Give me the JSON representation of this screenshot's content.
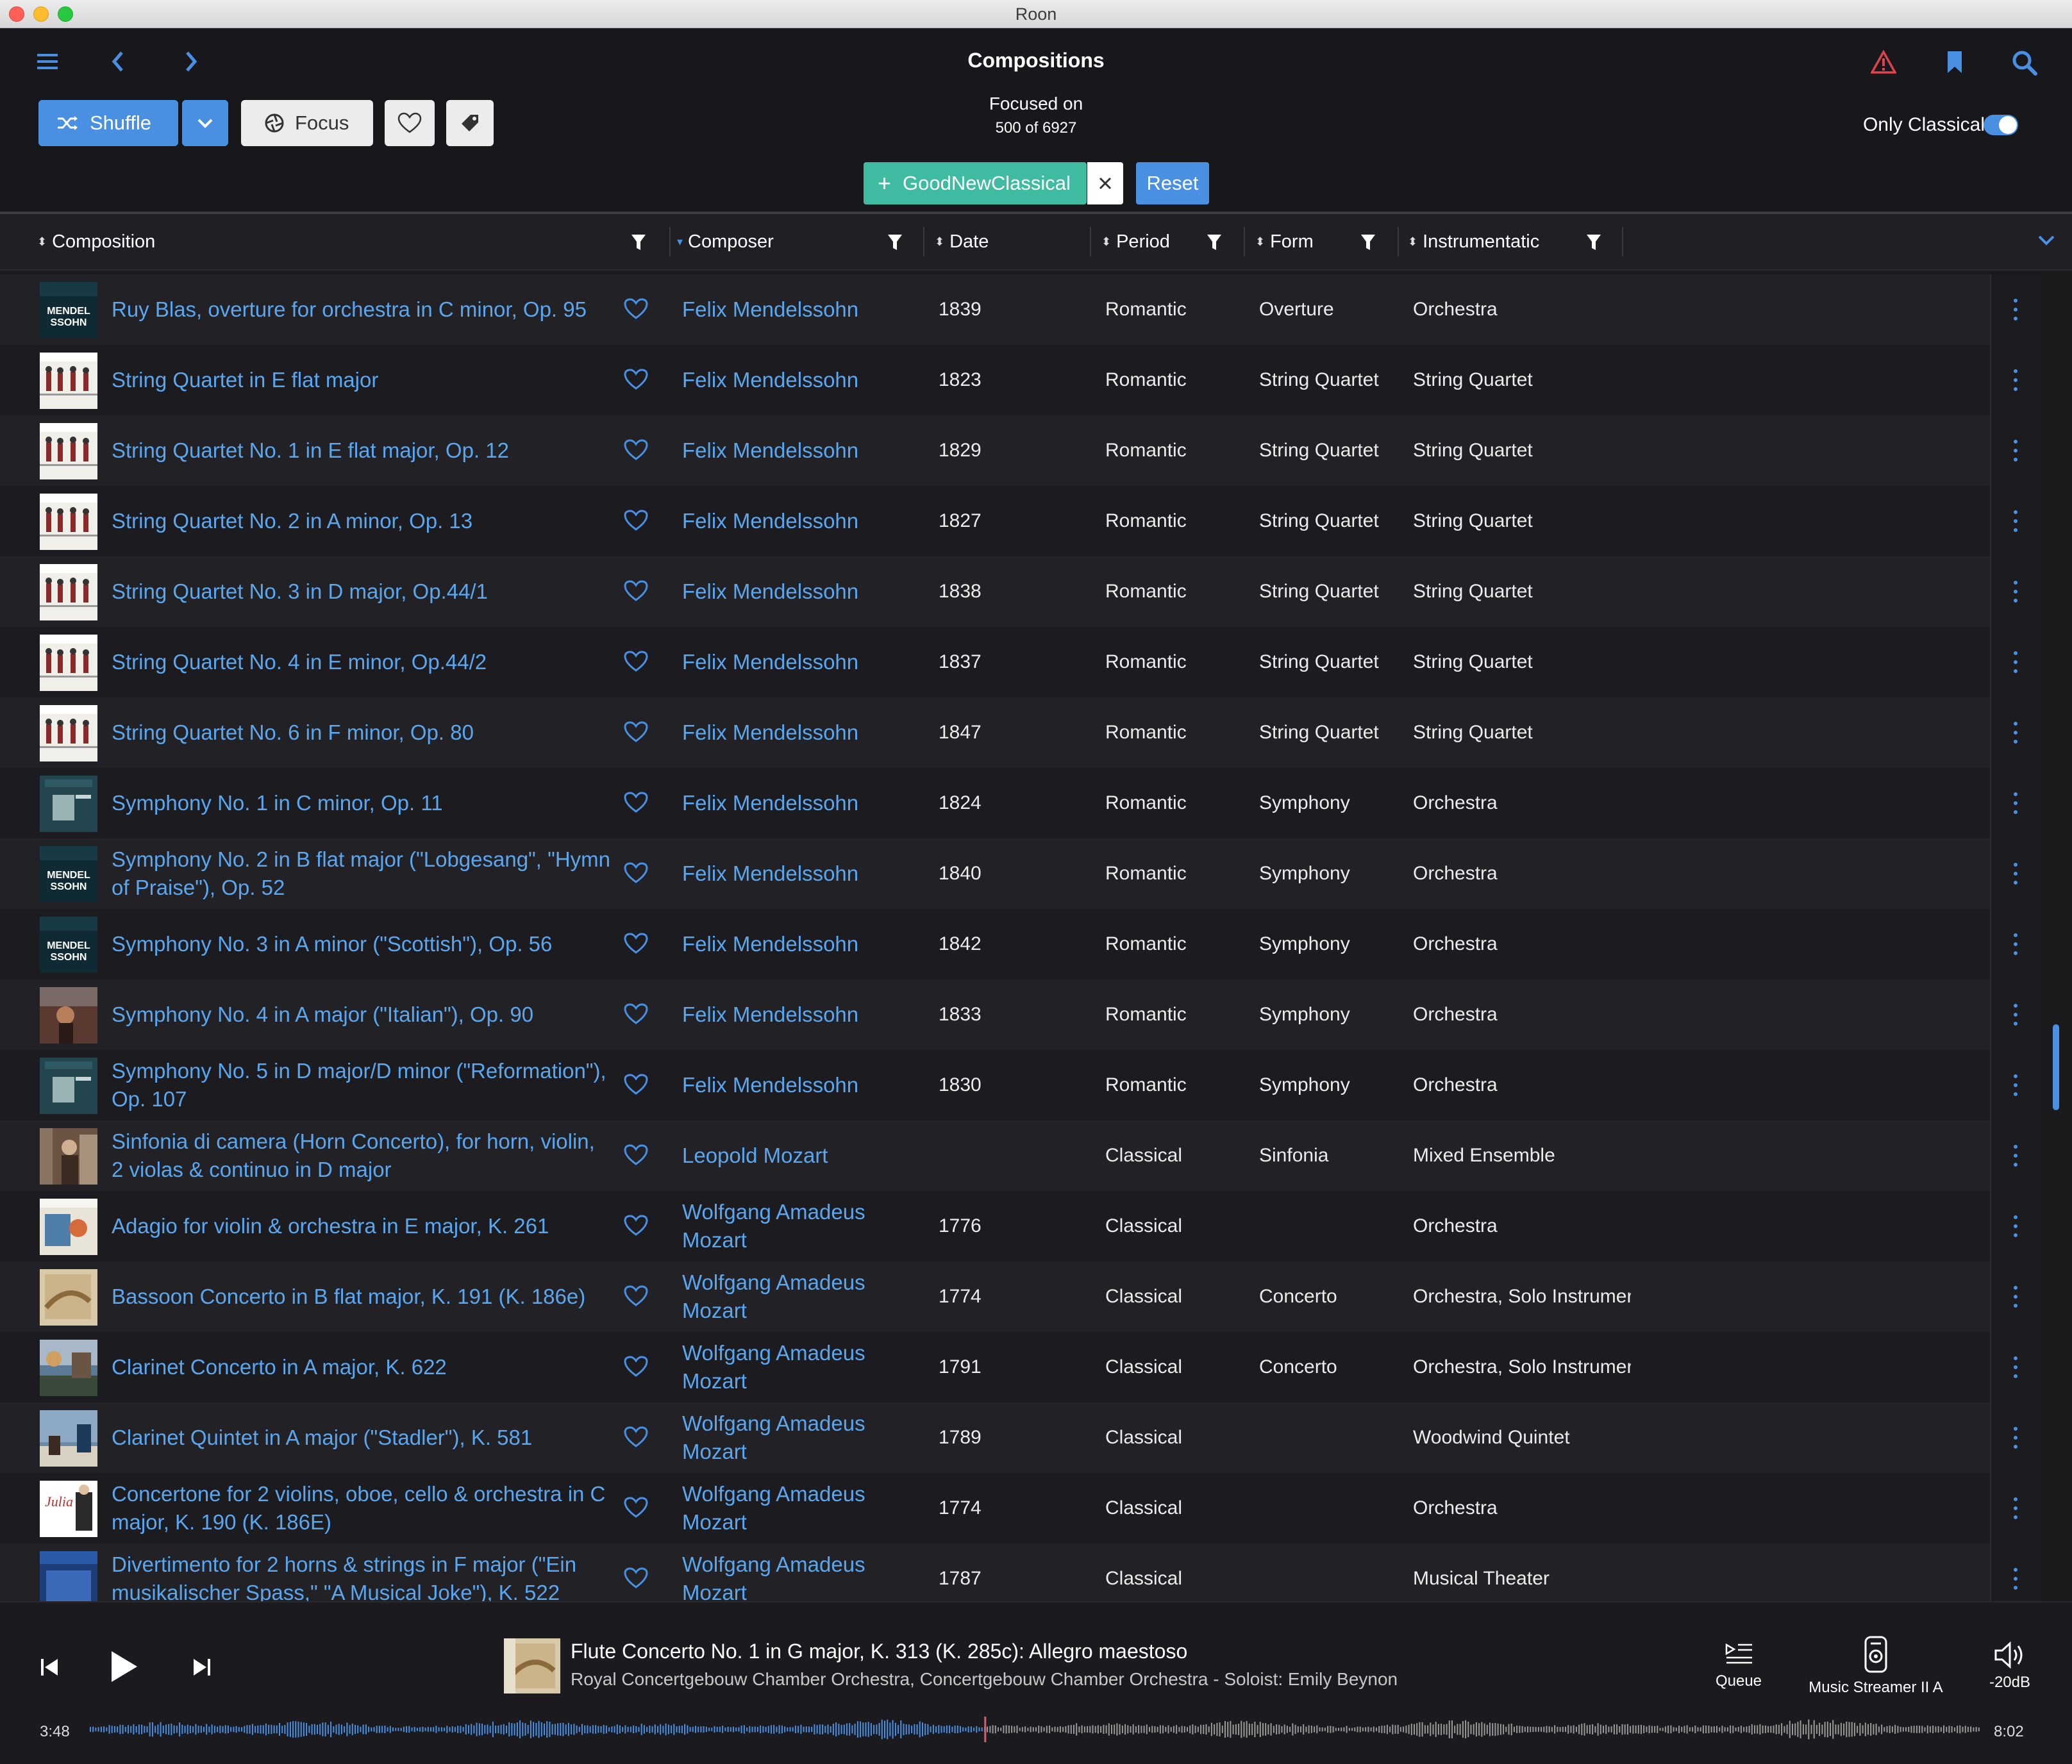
{
  "window": {
    "title": "Roon"
  },
  "header": {
    "page_title": "Compositions",
    "focused_label": "Focused on",
    "focused_count": "500 of 6927",
    "shuffle_label": "Shuffle",
    "focus_label": "Focus",
    "filter_chip": "GoodNewClassical",
    "reset_label": "Reset",
    "only_classical_label": "Only Classical",
    "only_classical_on": true
  },
  "columns": {
    "composition": "Composition",
    "composer": "Composer",
    "date": "Date",
    "period": "Period",
    "form": "Form",
    "instrumentation": "Instrumentatic"
  },
  "rows": [
    {
      "title": "Ruy Blas, overture for orchestra in C minor, Op. 95",
      "composer": "Felix Mendelssohn",
      "date": "1839",
      "period": "Romantic",
      "form": "Overture",
      "instrumentation": "Orchestra",
      "art": "mendelssohn"
    },
    {
      "title": "String Quartet in E flat major",
      "composer": "Felix Mendelssohn",
      "date": "1823",
      "period": "Romantic",
      "form": "String Quartet",
      "instrumentation": "String Quartet",
      "art": "quartet"
    },
    {
      "title": "String Quartet No. 1 in E flat major, Op. 12",
      "composer": "Felix Mendelssohn",
      "date": "1829",
      "period": "Romantic",
      "form": "String Quartet",
      "instrumentation": "String Quartet",
      "art": "quartet"
    },
    {
      "title": "String Quartet No. 2 in A minor, Op. 13",
      "composer": "Felix Mendelssohn",
      "date": "1827",
      "period": "Romantic",
      "form": "String Quartet",
      "instrumentation": "String Quartet",
      "art": "quartet"
    },
    {
      "title": "String Quartet No. 3 in D major, Op.44/1",
      "composer": "Felix Mendelssohn",
      "date": "1838",
      "period": "Romantic",
      "form": "String Quartet",
      "instrumentation": "String Quartet",
      "art": "quartet"
    },
    {
      "title": "String Quartet No. 4 in E minor, Op.44/2",
      "composer": "Felix Mendelssohn",
      "date": "1837",
      "period": "Romantic",
      "form": "String Quartet",
      "instrumentation": "String Quartet",
      "art": "quartet"
    },
    {
      "title": "String Quartet No. 6 in F minor, Op. 80",
      "composer": "Felix Mendelssohn",
      "date": "1847",
      "period": "Romantic",
      "form": "String Quartet",
      "instrumentation": "String Quartet",
      "art": "quartet"
    },
    {
      "title": "Symphony No. 1 in C minor, Op. 11",
      "composer": "Felix Mendelssohn",
      "date": "1824",
      "period": "Romantic",
      "form": "Symphony",
      "instrumentation": "Orchestra",
      "art": "teal"
    },
    {
      "title": "Symphony No. 2 in B flat major (\"Lobgesang\", \"Hymn of Praise\"), Op. 52",
      "composer": "Felix Mendelssohn",
      "date": "1840",
      "period": "Romantic",
      "form": "Symphony",
      "instrumentation": "Orchestra",
      "art": "mendelssohn"
    },
    {
      "title": "Symphony No. 3 in A minor (\"Scottish\"), Op. 56",
      "composer": "Felix Mendelssohn",
      "date": "1842",
      "period": "Romantic",
      "form": "Symphony",
      "instrumentation": "Orchestra",
      "art": "mendelssohn"
    },
    {
      "title": "Symphony No. 4 in A major (\"Italian\"), Op. 90",
      "composer": "Felix Mendelssohn",
      "date": "1833",
      "period": "Romantic",
      "form": "Symphony",
      "instrumentation": "Orchestra",
      "art": "painting"
    },
    {
      "title": "Symphony No. 5 in D major/D minor (\"Reformation\"), Op. 107",
      "composer": "Felix Mendelssohn",
      "date": "1830",
      "period": "Romantic",
      "form": "Symphony",
      "instrumentation": "Orchestra",
      "art": "teal"
    },
    {
      "title": "Sinfonia di camera (Horn Concerto), for horn, violin, 2 violas & continuo in D major",
      "composer": "Leopold Mozart",
      "date": "",
      "period": "Classical",
      "form": "Sinfonia",
      "instrumentation": "Mixed Ensemble",
      "art": "brown"
    },
    {
      "title": "Adagio for violin & orchestra in E major, K. 261",
      "composer": "Wolfgang Amadeus Mozart",
      "date": "1776",
      "period": "Classical",
      "form": "",
      "instrumentation": "Orchestra",
      "art": "blueprint"
    },
    {
      "title": "Bassoon Concerto in B flat major, K. 191 (K. 186e)",
      "composer": "Wolfgang Amadeus Mozart",
      "date": "1774",
      "period": "Classical",
      "form": "Concerto",
      "instrumentation": "Orchestra, Solo Instrumer",
      "art": "beige"
    },
    {
      "title": "Clarinet Concerto in A major, K. 622",
      "composer": "Wolfgang Amadeus Mozart",
      "date": "1791",
      "period": "Classical",
      "form": "Concerto",
      "instrumentation": "Orchestra, Solo Instrumer",
      "art": "landscape"
    },
    {
      "title": "Clarinet Quintet in A major (\"Stadler\"), K. 581",
      "composer": "Wolfgang Amadeus Mozart",
      "date": "1789",
      "period": "Classical",
      "form": "",
      "instrumentation": "Woodwind Quintet",
      "art": "landscape2"
    },
    {
      "title": "Concertone for 2 violins, oboe, cello & orchestra in C major, K. 190 (K. 186E)",
      "composer": "Wolfgang Amadeus Mozart",
      "date": "1774",
      "period": "Classical",
      "form": "",
      "instrumentation": "Orchestra",
      "art": "julia"
    },
    {
      "title": "Divertimento for 2 horns & strings in F major (\"Ein musikalischer Spass,\" \"A Musical Joke\"), K. 522",
      "composer": "Wolfgang Amadeus Mozart",
      "date": "1787",
      "period": "Classical",
      "form": "",
      "instrumentation": "Musical Theater",
      "art": "bluecover"
    }
  ],
  "player": {
    "track_title": "Flute Concerto No. 1 in G major, K. 313 (K. 285c): Allegro maestoso",
    "track_artist": "Royal Concertgebouw Chamber Orchestra, Concertgebouw Chamber Orchestra - Soloist: Emily Beynon",
    "queue_label": "Queue",
    "zone_label": "Music Streamer II A",
    "volume_label": "-20dB",
    "elapsed": "3:48",
    "total": "8:02",
    "progress": 0.473
  },
  "colors": {
    "accent": "#4a90e2",
    "link": "#5aa7f0",
    "chip": "#3fbba1",
    "alert": "#e0424b",
    "playhead": "#e05a6a"
  }
}
